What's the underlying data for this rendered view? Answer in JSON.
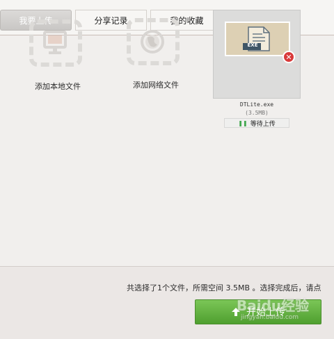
{
  "tabs": [
    {
      "label": "我要上传",
      "active": true
    },
    {
      "label": "分享记录",
      "active": false
    },
    {
      "label": "我的收藏",
      "active": false
    }
  ],
  "add_local": {
    "label": "添加本地文件",
    "icon": "monitor-icon"
  },
  "add_network": {
    "label": "添加网络文件",
    "icon": "globe-icon"
  },
  "file": {
    "name": "DTLite.exe",
    "size": "(3.5MB)",
    "badge": "EXE",
    "status": "等待上传",
    "status_icon": "pause-icon",
    "remove_glyph": "✕"
  },
  "footer": {
    "summary": "共选择了1个文件，所需空间 3.5MB 。选择完成后，请点",
    "start_label": "开始上传",
    "start_icon": "upload-arrow-icon"
  },
  "watermark": {
    "text": "Baidu经验",
    "sub": "jingyan.baidu.com"
  },
  "colors": {
    "accent_green": "#5aad38",
    "close_red": "#d93a3a",
    "tab_active": "#cfcdcb",
    "thumb_bg": "#ddd0b4"
  }
}
